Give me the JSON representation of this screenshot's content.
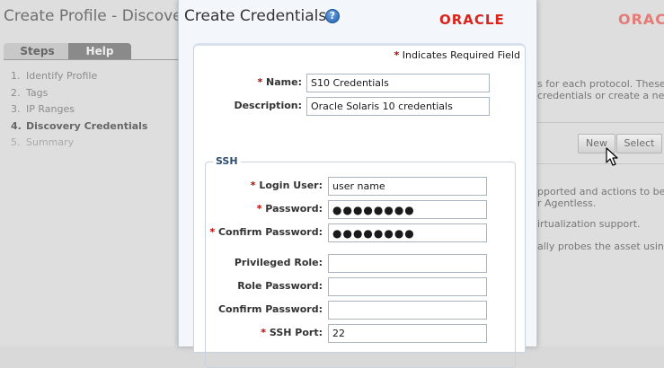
{
  "background": {
    "title": "Create Profile - Discovery Credentials",
    "brand": "ORACLE",
    "tabs": {
      "steps": "Steps",
      "help": "Help"
    },
    "steps": [
      {
        "num": "1.",
        "label": "Identify Profile"
      },
      {
        "num": "2.",
        "label": "Tags"
      },
      {
        "num": "3.",
        "label": "IP Ranges"
      },
      {
        "num": "4.",
        "label": "Discovery Credentials"
      },
      {
        "num": "5.",
        "label": "Summary"
      }
    ],
    "right_text": {
      "line1": "s for each protocol. These",
      "line2": "credentials or create a new se",
      "line3": "pported and actions to be avail",
      "line4": "r Agentless.",
      "line5": "irtualization support.",
      "line6": "ally probes the asset using SS"
    },
    "buttons": {
      "new": "New",
      "select": "Select"
    }
  },
  "dialog": {
    "title": "Create Credentials",
    "help_glyph": "?",
    "brand": "ORACLE",
    "required_note": "Indicates Required Field",
    "asterisk": "*",
    "name": {
      "label": "Name:",
      "value": "S10 Credentials"
    },
    "description": {
      "label": "Description:",
      "value": "Oracle Solaris 10 credentials"
    },
    "ssh": {
      "legend": "SSH",
      "login_user": {
        "label": "Login User:",
        "value": "user name"
      },
      "password": {
        "label": "Password:",
        "value": "●●●●●●●●"
      },
      "confirm_password": {
        "label": "Confirm Password:",
        "value": "●●●●●●●●"
      },
      "privileged_role": {
        "label": "Privileged Role:",
        "value": ""
      },
      "role_password": {
        "label": "Role Password:",
        "value": ""
      },
      "confirm_role_password": {
        "label": "Confirm Password:",
        "value": ""
      },
      "ssh_port": {
        "label": "SSH Port:",
        "value": "22"
      }
    }
  }
}
